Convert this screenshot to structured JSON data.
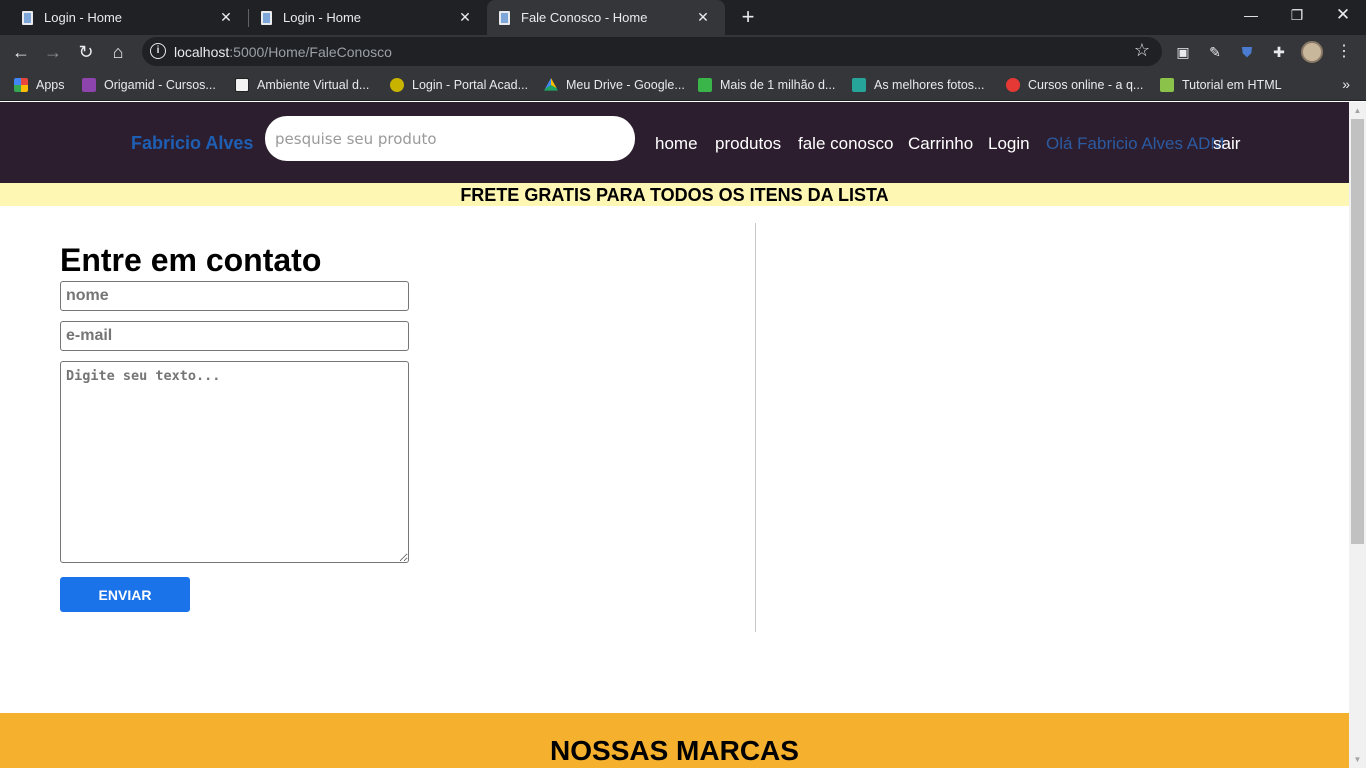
{
  "browser": {
    "tabs": [
      {
        "title": "Login - Home",
        "active": false
      },
      {
        "title": "Login - Home",
        "active": false
      },
      {
        "title": "Fale Conosco - Home",
        "active": true
      }
    ],
    "address": {
      "host": "localhost",
      "path": ":5000/Home/FaleConosco"
    },
    "bookmarks": [
      {
        "label": "Apps",
        "icon": "apps-grid-icon",
        "color": "#e8453c"
      },
      {
        "label": "Origamid - Cursos...",
        "icon": "origamid-icon",
        "color": "#8e44ad"
      },
      {
        "label": "Ambiente Virtual d...",
        "icon": "blackboard-icon",
        "color": "#222222"
      },
      {
        "label": "Login - Portal Acad...",
        "icon": "portal-icon",
        "color": "#c8b400"
      },
      {
        "label": "Meu Drive - Google...",
        "icon": "google-drive-icon",
        "color": "#1fa463"
      },
      {
        "label": "Mais de 1 milhão d...",
        "icon": "px-icon",
        "color": "#3ab549"
      },
      {
        "label": "As melhores fotos...",
        "icon": "photos-icon",
        "color": "#26a69a"
      },
      {
        "label": "Cursos online - a q...",
        "icon": "udemy-icon",
        "color": "#e53935"
      },
      {
        "label": "Tutorial em HTML",
        "icon": "tutorial-icon",
        "color": "#8bc34a"
      }
    ]
  },
  "header": {
    "brand": "Fabricio Alves",
    "search_placeholder": "pesquise seu produto",
    "nav": {
      "home": "home",
      "produtos": "produtos",
      "fale_conosco": "fale conosco",
      "carrinho": "Carrinho",
      "login": "Login",
      "user": "Olá Fabricio Alves ADM",
      "sair": "sair"
    }
  },
  "promo": "FRETE GRATIS PARA TODOS OS ITENS DA LISTA",
  "contact": {
    "title": "Entre em contato",
    "name_placeholder": "nome",
    "email_placeholder": "e-mail",
    "message_placeholder": "Digite seu texto...",
    "submit": "ENVIAR"
  },
  "brands_title": "NOSSAS MARCAS",
  "colors": {
    "header_bg": "#2d1e2f",
    "brand": "#1e5fb4",
    "promo_bg": "#fef6b3",
    "button": "#1a73e8",
    "brands_bg": "#f5b02e"
  }
}
